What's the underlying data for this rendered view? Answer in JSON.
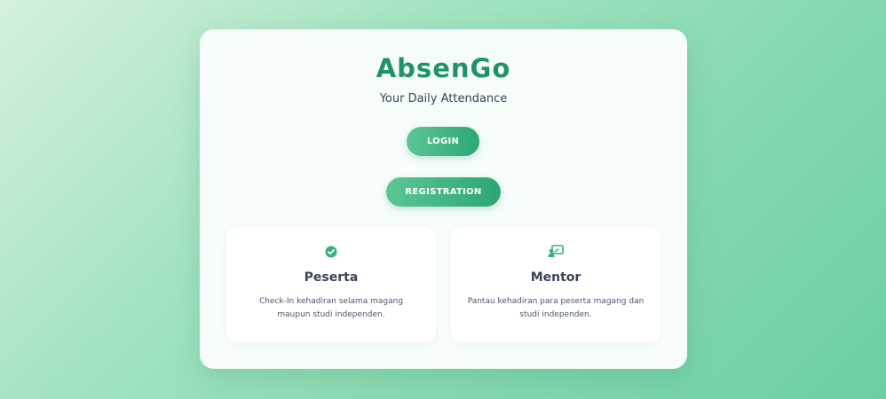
{
  "app": {
    "title": "AbsenGo",
    "subtitle": "Your Daily Attendance"
  },
  "actions": {
    "login_label": "LOGIN",
    "registration_label": "REGISTRATION"
  },
  "features": [
    {
      "icon": "check-circle-icon",
      "title": "Peserta",
      "description": "Check-In kehadiran selama magang maupun studi independen."
    },
    {
      "icon": "chalkboard-teacher-icon",
      "title": "Mentor",
      "description": "Pantau kehadiran para peserta magang dan studi independen."
    }
  ],
  "colors": {
    "brand": "#1e9466",
    "accent": "#2ba774",
    "text": "#3a4458"
  }
}
